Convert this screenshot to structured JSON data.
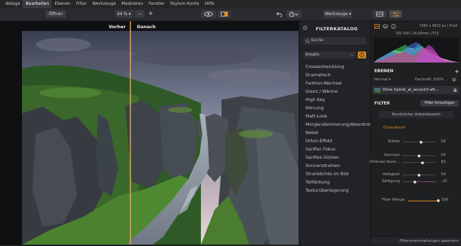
{
  "menu": {
    "items": [
      "Ablage",
      "Bearbeiten",
      "Ebenen",
      "Filter",
      "Werkzeuge",
      "Maskieren",
      "Fenster",
      "Skylum-Konto",
      "Hilfe"
    ],
    "active_index": 1
  },
  "toolbar": {
    "open_label": "Öffnen",
    "zoom_label": "44 % ▾",
    "minus_label": "−",
    "plus_label": "+",
    "tools_label": "Werkzeuge ▾"
  },
  "compare": {
    "before_label": "Vorher",
    "after_label": "Danach",
    "split_fraction": 0.35
  },
  "catalog": {
    "title": "FILTERKATALOG",
    "search_placeholder": "Suche",
    "category": "Kreativ",
    "filters": [
      "Crossentwicklung",
      "Dramatisch",
      "Farbton-Wechsel",
      "Glanz / Wärme",
      "High Key",
      "Körnung",
      "Matt-Look",
      "Morgendämmerung/Abendrot",
      "Nebel",
      "Orton-Effekt",
      "Sanfter Fokus",
      "Sanftes Glühen",
      "Sonnenstrahlen",
      "Strahldichte im Bild",
      "Teilfärbung",
      "Texturüberlagerung"
    ]
  },
  "info": {
    "dimensions": "7360 x 4912 px | 8-bit",
    "exif": "ISO 100 | 16,00mm | F13"
  },
  "layers": {
    "header": "EBENEN",
    "blend_mode": "Normal",
    "opacity": "Deckraft: 100%",
    "layer_name": "Dima Sytnik_ai_accent3-aft..."
  },
  "filter_panel": {
    "header": "FILTER",
    "add_button": "Filter hinzufügen",
    "workspace_label": "Persönlicher Arbeitsbereich",
    "active_filter": "Dramatisch",
    "sliders": [
      {
        "label": "Stärke",
        "value": "56",
        "fraction": 0.56
      },
      {
        "label": "Kontrast",
        "value": "50",
        "fraction": 0.5
      },
      {
        "label": "Örtlicher Kontr...",
        "value": "60",
        "fraction": 0.6
      },
      {
        "label": "Helligkeit",
        "value": "50",
        "fraction": 0.5
      },
      {
        "label": "Sättigung",
        "value": "-25",
        "fraction": 0.375
      }
    ],
    "amount_label": "Filter Menge",
    "amount_value": "100",
    "amount_fraction": 1.0,
    "save_label": "Filtervoreinstellungen speichern"
  },
  "colors": {
    "accent": "#e28a1e",
    "highlight_blue": "#2d6fb5",
    "panel_bg": "#222326"
  }
}
